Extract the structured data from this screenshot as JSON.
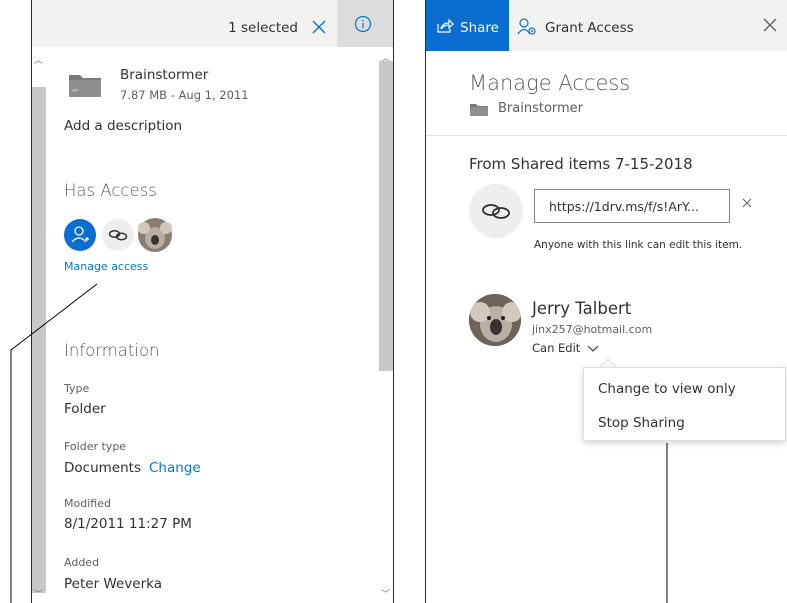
{
  "details_pane": {
    "header": {
      "selected_text": "1 selected"
    },
    "item": {
      "name": "Brainstormer",
      "meta": "7.87 MB - Aug 1, 2011"
    },
    "add_description": "Add a description",
    "has_access": {
      "heading": "Has Access",
      "manage_link": "Manage access"
    },
    "information": {
      "heading": "Information",
      "type_label": "Type",
      "type_value": "Folder",
      "folder_type_label": "Folder type",
      "folder_type_value": "Documents",
      "folder_type_change": "Change",
      "modified_label": "Modified",
      "modified_value": "8/1/2011 11:27 PM",
      "added_label": "Added",
      "added_value": "Peter Weverka"
    }
  },
  "manage_access_pane": {
    "toolbar": {
      "share_label": "Share",
      "grant_label": "Grant Access"
    },
    "title": "Manage Access",
    "folder_name": "Brainstormer",
    "shared_group": "From Shared items 7-15-2018",
    "link": {
      "url": "https://1drv.ms/f/s!ArY...",
      "description": "Anyone with this link can edit this item."
    },
    "person": {
      "name": "Jerry Talbert",
      "email": "jinx257@hotmail.com",
      "permission": "Can Edit"
    },
    "permission_menu": [
      "Change to view only",
      "Stop Sharing"
    ]
  },
  "colors": {
    "accent": "#0078d4",
    "share_tab": "#0a6ed1",
    "header_bg": "#f3f2f1"
  }
}
